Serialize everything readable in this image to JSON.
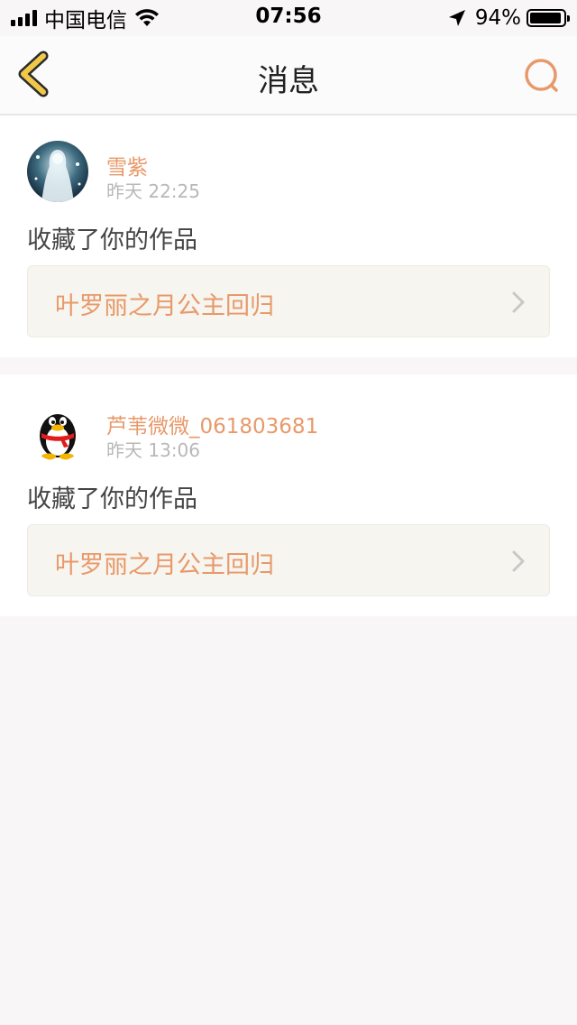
{
  "status_bar": {
    "carrier": "中国电信",
    "time": "07:56",
    "battery_percent_text": "94%",
    "battery_level": 0.94,
    "icons": [
      "signal-bars-icon",
      "wifi-icon",
      "location-arrow-icon",
      "battery-icon"
    ]
  },
  "nav": {
    "title": "消息",
    "back_icon": "chevron-left-icon",
    "search_icon": "search-icon"
  },
  "colors": {
    "accent": "#e8996a",
    "back_arrow": "#f2c84b",
    "background": "#f8f6f6",
    "card": "#ffffff",
    "link_box": "#f6f5ef"
  },
  "messages": [
    {
      "username": "雪紫",
      "time": "昨天 22:25",
      "action": "收藏了你的作品",
      "work_title": "叶罗丽之月公主回归",
      "avatar": "anime-avatar"
    },
    {
      "username": "芦苇微微_061803681",
      "time": "昨天 13:06",
      "action": "收藏了你的作品",
      "work_title": "叶罗丽之月公主回归",
      "avatar": "qq-penguin-avatar"
    }
  ]
}
